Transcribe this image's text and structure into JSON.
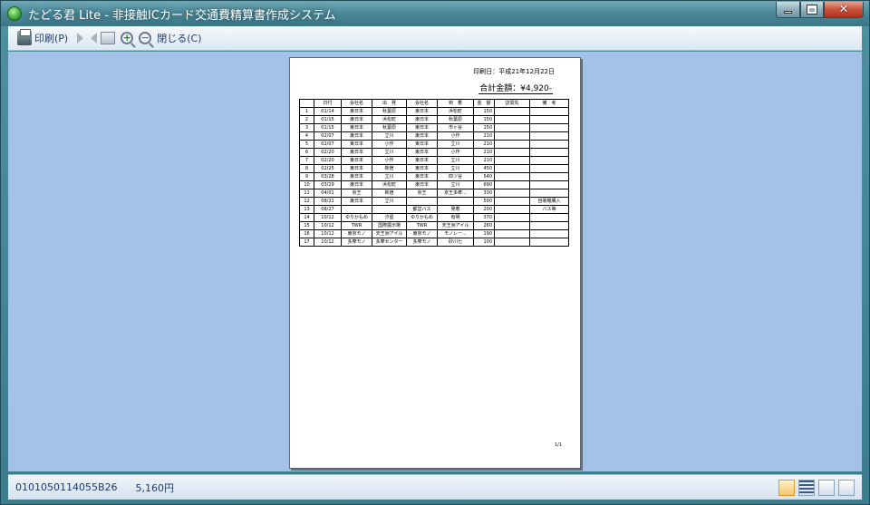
{
  "window": {
    "title": "たどる君 Lite - 非接触ICカード交通費精算書作成システム"
  },
  "toolbar": {
    "print_label": "印刷(P)",
    "close_label": "閉じる(C)"
  },
  "document": {
    "print_date": "印刷日：平成21年12月22日",
    "total": "合計金額：¥4,920-",
    "page_number": "1/1",
    "columns": [
      "",
      "日付",
      "会社名",
      "出　発",
      "会社名",
      "到　着",
      "金　額",
      "訪問先",
      "備　考"
    ],
    "rows": [
      [
        "1",
        "01/14",
        "東日本",
        "秋葉原",
        "東日本",
        "浜松町",
        "150",
        "",
        ""
      ],
      [
        "2",
        "01/15",
        "東日本",
        "浜松町",
        "東日本",
        "秋葉原",
        "150",
        "",
        ""
      ],
      [
        "3",
        "01/15",
        "東日本",
        "秋葉原",
        "東日本",
        "市ヶ谷",
        "150",
        "",
        ""
      ],
      [
        "4",
        "02/07",
        "東日本",
        "立川",
        "東日本",
        "小作",
        "210",
        "",
        ""
      ],
      [
        "5",
        "02/07",
        "東日本",
        "小作",
        "東日本",
        "立川",
        "210",
        "",
        ""
      ],
      [
        "6",
        "02/20",
        "東日本",
        "立川",
        "東日本",
        "小作",
        "210",
        "",
        ""
      ],
      [
        "7",
        "02/20",
        "東日本",
        "小作",
        "東日本",
        "立川",
        "210",
        "",
        ""
      ],
      [
        "8",
        "02/25",
        "東日本",
        "新宿",
        "東日本",
        "立川",
        "450",
        "",
        ""
      ],
      [
        "9",
        "03/28",
        "東日本",
        "立川",
        "東日本",
        "四ツ谷",
        "540",
        "",
        ""
      ],
      [
        "10",
        "03/29",
        "東日本",
        "浜松町",
        "東日本",
        "立川",
        "690",
        "",
        ""
      ],
      [
        "11",
        "04/01",
        "京王",
        "新宿",
        "京王",
        "京王多摩…",
        "330",
        "",
        ""
      ],
      [
        "12",
        "08/21",
        "東日本",
        "立川",
        "",
        "",
        "500",
        "",
        "自販機購入"
      ],
      [
        "13",
        "08/27",
        "",
        "",
        "都営バス",
        "発着",
        "200",
        "",
        "バス等"
      ],
      [
        "14",
        "10/12",
        "ゆりかもめ",
        "汐留",
        "ゆりかもめ",
        "有明",
        "370",
        "",
        ""
      ],
      [
        "15",
        "10/12",
        "TWR",
        "国際展示場",
        "TWR",
        "天王洲アイル",
        "260",
        "",
        ""
      ],
      [
        "16",
        "10/12",
        "東京モノ",
        "天王洲アイル",
        "東京モノ",
        "モノレー…",
        "190",
        "",
        ""
      ],
      [
        "17",
        "10/12",
        "多摩モノ",
        "多摩センター",
        "多摩モノ",
        "砂川七",
        "100",
        "",
        ""
      ]
    ]
  },
  "status": {
    "card_id": "0101050114055B26",
    "balance": "5,160円"
  },
  "icons": {
    "app": "tadoru-app-icon",
    "print": "printer-icon",
    "next": "next-page-icon",
    "prev": "prev-page-icon",
    "page": "single-page-icon",
    "zoom_in": "zoom-in-icon",
    "zoom_out": "zoom-out-icon"
  },
  "colors": {
    "preview_bg": "#a4c2e8",
    "titlebar": "#4a8797"
  }
}
